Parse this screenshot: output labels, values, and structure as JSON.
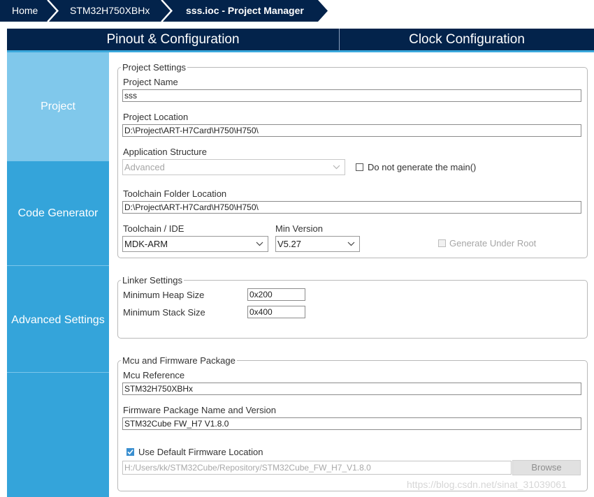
{
  "breadcrumb": {
    "home": "Home",
    "device": "STM32H750XBHx",
    "current": "sss.ioc - Project Manager"
  },
  "tabs": {
    "pinout": "Pinout & Configuration",
    "clock": "Clock Configuration"
  },
  "sidebar": {
    "items": [
      {
        "label": "Project",
        "selected": true
      },
      {
        "label": "Code Generator",
        "selected": false
      },
      {
        "label": "Advanced Settings",
        "selected": false
      }
    ]
  },
  "project_settings": {
    "legend": "Project Settings",
    "project_name_label": "Project Name",
    "project_name": "sss",
    "project_location_label": "Project Location",
    "project_location": "D:\\Project\\ART-H7Card\\H750\\H750\\",
    "app_structure_label": "Application Structure",
    "app_structure": "Advanced",
    "no_main_label": "Do not generate the main()",
    "no_main_checked": false,
    "toolchain_folder_label": "Toolchain Folder Location",
    "toolchain_folder": "D:\\Project\\ART-H7Card\\H750\\H750\\",
    "toolchain_label": "Toolchain / IDE",
    "toolchain": "MDK-ARM",
    "min_version_label": "Min Version",
    "min_version": "V5.27",
    "gen_under_root_label": "Generate Under Root",
    "gen_under_root_checked": false
  },
  "linker_settings": {
    "legend": "Linker Settings",
    "heap_label": "Minimum Heap Size",
    "heap": "0x200",
    "stack_label": "Minimum Stack Size",
    "stack": "0x400"
  },
  "mcu_firmware": {
    "legend": "Mcu and Firmware Package",
    "mcu_ref_label": "Mcu Reference",
    "mcu_ref": "STM32H750XBHx",
    "fw_label": "Firmware Package Name and Version",
    "fw": "STM32Cube FW_H7 V1.8.0",
    "use_default_label": "Use Default Firmware Location",
    "use_default_checked": true,
    "fw_location": "H:/Users/kk/STM32Cube/Repository/STM32Cube_FW_H7_V1.8.0",
    "browse_label": "Browse"
  },
  "watermark": "https://blog.csdn.net/sinat_31039061",
  "colors": {
    "nav_dark": "#03234b",
    "sidebar": "#34a4da",
    "sidebar_selected": "#80c8eb"
  }
}
